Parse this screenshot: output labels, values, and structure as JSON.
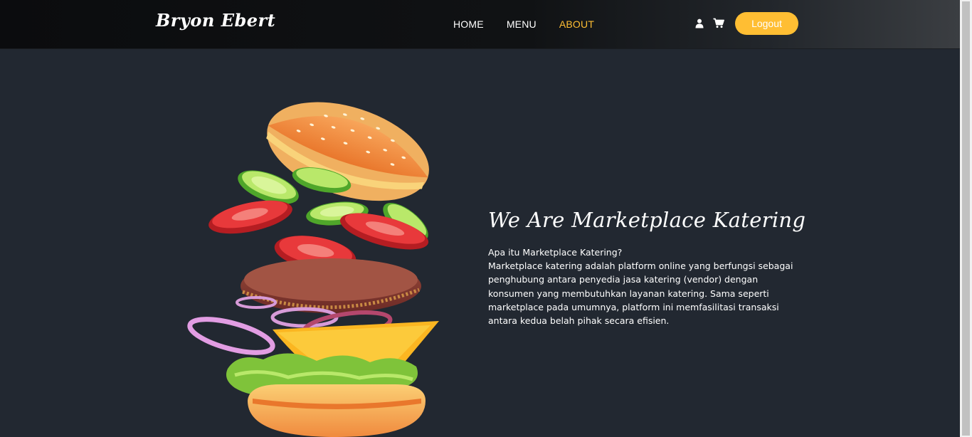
{
  "header": {
    "brand": "Bryon Ebert",
    "nav": [
      {
        "label": "HOME",
        "active": false
      },
      {
        "label": "MENU",
        "active": false
      },
      {
        "label": "ABOUT",
        "active": true
      }
    ],
    "icons": [
      "user-icon",
      "cart-icon"
    ],
    "logout_label": "Logout"
  },
  "about": {
    "title": "We Are Marketplace Katering",
    "question": "Apa itu Marketplace Katering?",
    "body": "Marketplace katering adalah platform online yang berfungsi sebagai penghubung antara penyedia jasa katering (vendor) dengan konsumen yang membutuhkan layanan katering. Sama seperti marketplace pada umumnya, platform ini memfasilitasi transaksi antara kedua belah pihak secara efisien."
  },
  "image": {
    "subject": "burger-illustration"
  },
  "colors": {
    "accent": "#ffbe33",
    "background": "#222831",
    "header": "#0c0d0f",
    "text": "#ffffff"
  }
}
